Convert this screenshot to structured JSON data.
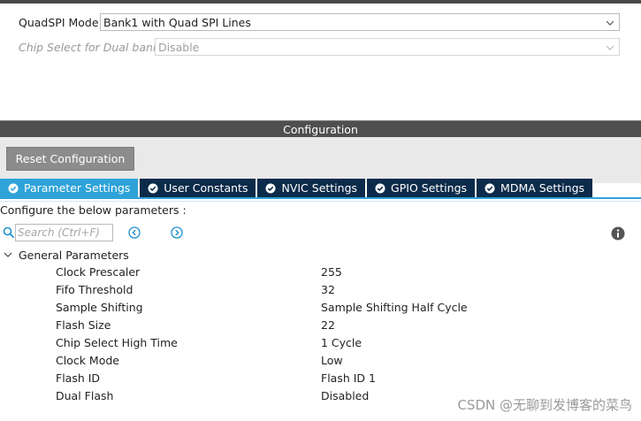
{
  "mode": {
    "quadspi_label": "QuadSPI Mode",
    "quadspi_value": "Bank1 with Quad SPI Lines",
    "chipselect_label": "Chip Select for Dual bank",
    "chipselect_value": "Disable"
  },
  "config_title": "Configuration",
  "reset_button": "Reset Configuration",
  "tabs": [
    {
      "label": "Parameter Settings",
      "active": true
    },
    {
      "label": "User Constants"
    },
    {
      "label": "NVIC Settings"
    },
    {
      "label": "GPIO Settings"
    },
    {
      "label": "MDMA Settings"
    }
  ],
  "configure_text": "Configure the below parameters :",
  "search": {
    "placeholder": "Search (Ctrl+F)"
  },
  "group": {
    "label": "General Parameters",
    "params": [
      {
        "name": "Clock Prescaler",
        "value": "255"
      },
      {
        "name": "Fifo Threshold",
        "value": "32"
      },
      {
        "name": "Sample Shifting",
        "value": "Sample Shifting Half Cycle"
      },
      {
        "name": "Flash Size",
        "value": "22"
      },
      {
        "name": "Chip Select High Time",
        "value": "1 Cycle"
      },
      {
        "name": "Clock Mode",
        "value": "Low"
      },
      {
        "name": "Flash ID",
        "value": "Flash ID 1"
      },
      {
        "name": "Dual Flash",
        "value": "Disabled"
      }
    ]
  },
  "watermark": "CSDN @无聊到发博客的菜鸟",
  "colors": {
    "tab_active": "#2ea3d8",
    "tab_inactive": "#0c2b4a",
    "config_bar": "#4f4f4f",
    "reset_button": "#8c8c8c"
  }
}
